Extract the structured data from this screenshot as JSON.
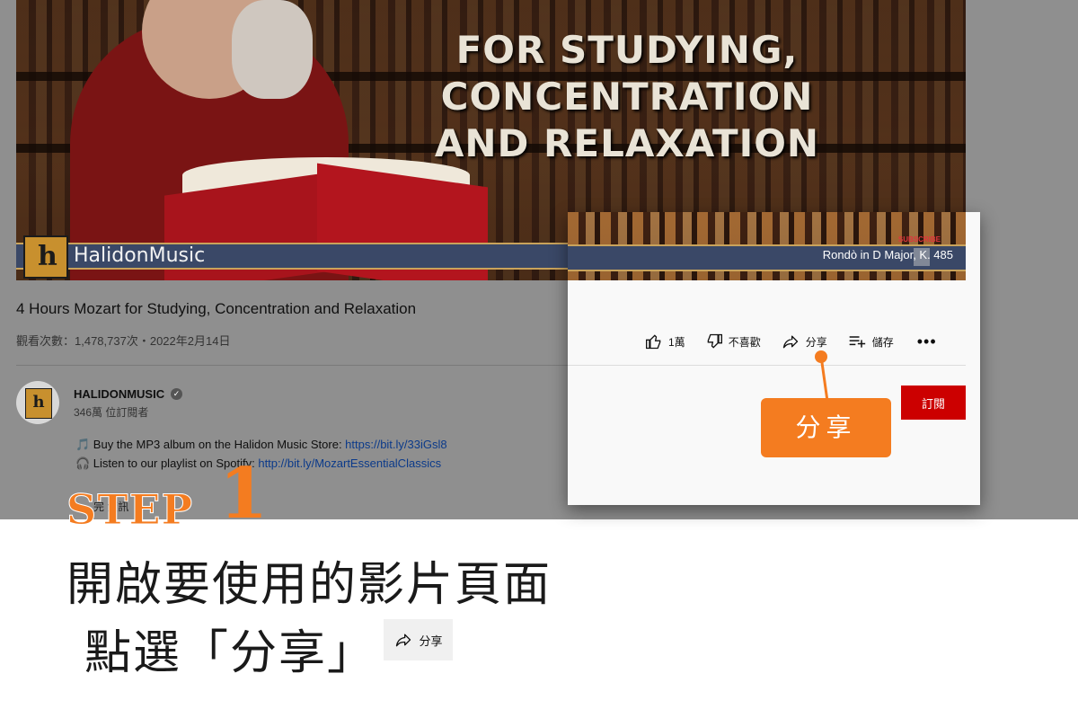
{
  "video": {
    "overlay_line1": "FOR STUDYING, CONCENTRATION",
    "overlay_line2": "AND RELAXATION",
    "brand_name": "HalidonMusic",
    "track_name": "Rondò in D Major, K. 485",
    "subscribe_tag": "SUBSCRIBE"
  },
  "meta": {
    "title": "4 Hours Mozart for Studying, Concentration and Relaxation",
    "views": "觀看次數：1,478,737次・2022年2月14日"
  },
  "channel": {
    "name": "HALIDONMUSIC",
    "subscribers": "346萬 位訂閱者",
    "verified_glyph": "✓"
  },
  "description": {
    "line1_prefix": "🎵 Buy the MP3 album on the Halidon Music Store: ",
    "line1_link": "https://bit.ly/33iGsl8",
    "line2_prefix": "🎧 Listen to our playlist on Spotify: ",
    "line2_link": "http://bit.ly/MozartEssentialClassics",
    "cut_text": "完 資訊"
  },
  "actions": {
    "like_count": "1萬",
    "dislike_label": "不喜歡",
    "share_label": "分享",
    "save_label": "儲存",
    "more_label": "•••",
    "subscribe_label": "訂閱"
  },
  "callout": {
    "label": "分享"
  },
  "instructions": {
    "step_word": "STEP",
    "step_number": "1",
    "line1": "開啟要使用的影片頁面",
    "line2": "點選「分享」",
    "chip_label": "分享"
  },
  "colors": {
    "accent_orange": "#f47c20",
    "subscribe_red": "#cc0000",
    "link_blue": "#0b3a8a"
  }
}
